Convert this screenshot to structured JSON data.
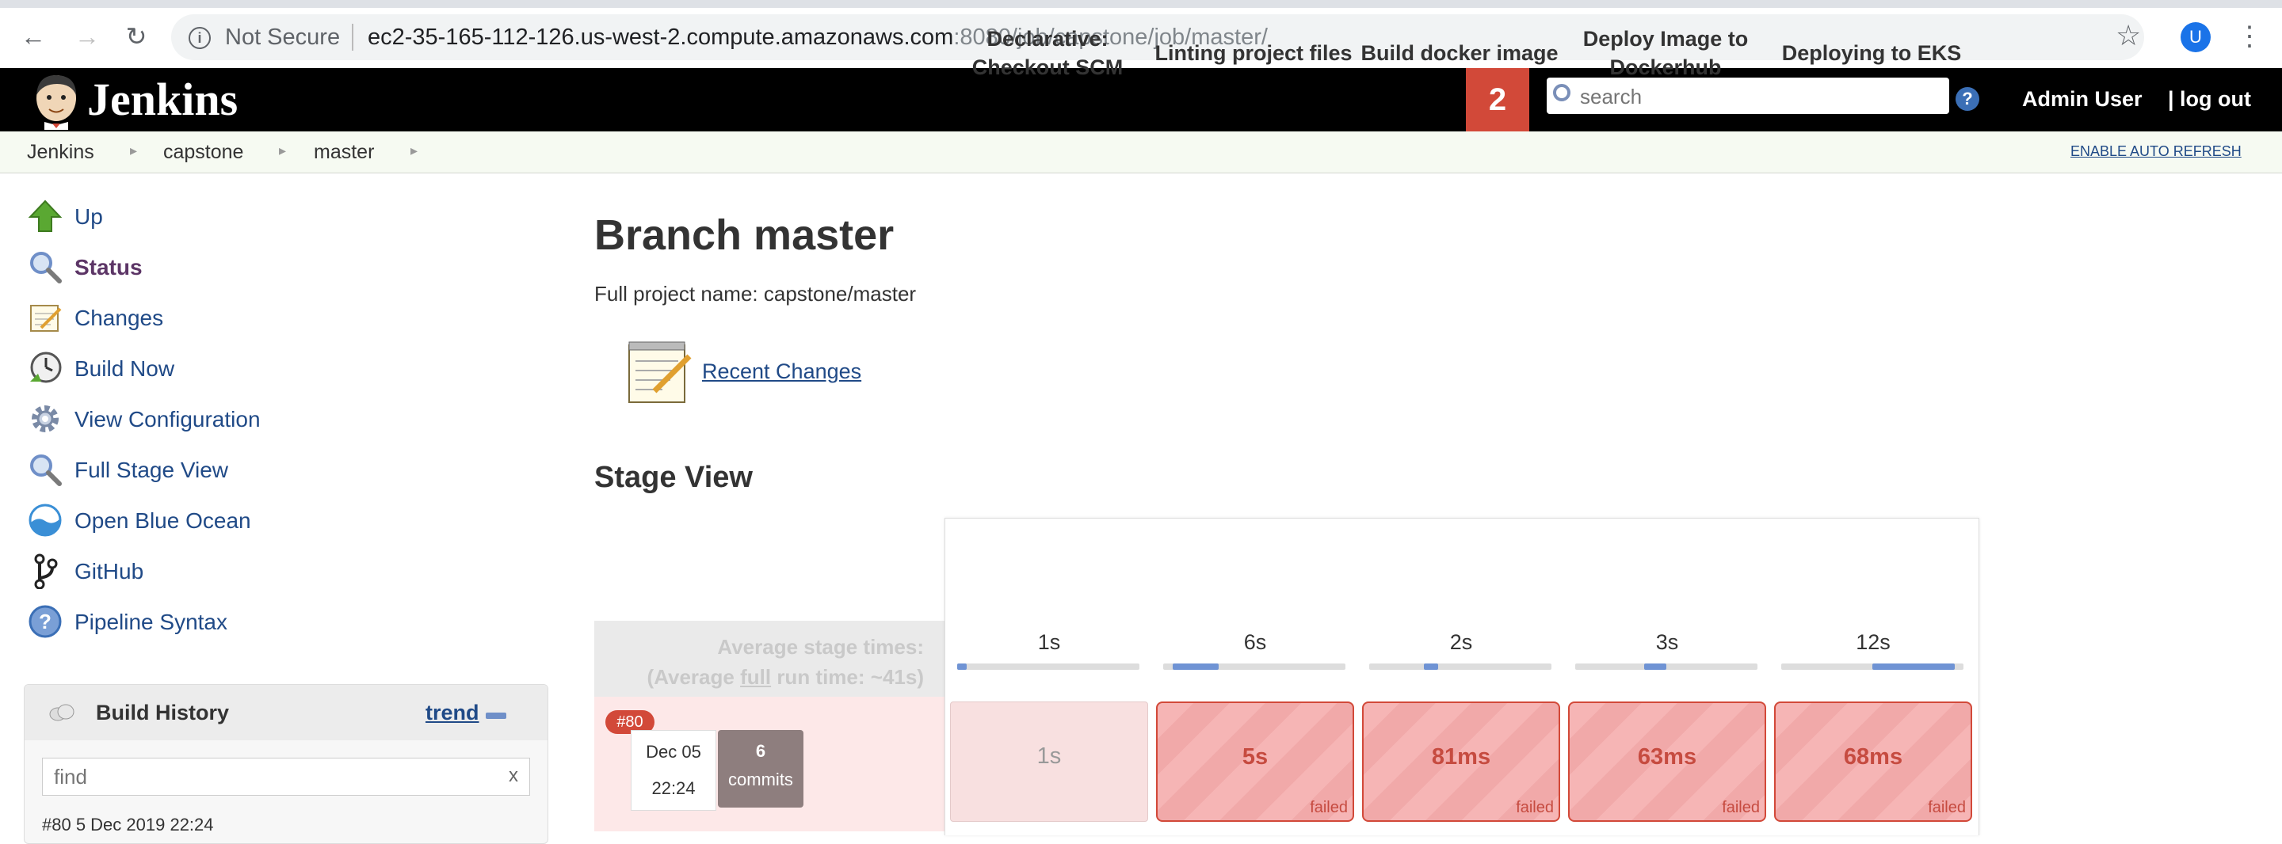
{
  "browser": {
    "security_label": "Not Secure",
    "url_host": "ec2-35-165-112-126.us-west-2.compute.amazonaws.com",
    "url_path": ":8080/job/capstone/job/master/",
    "profile_initial": "U"
  },
  "header": {
    "app_name": "Jenkins",
    "notification_count": "2",
    "search_placeholder": "search",
    "user": "Admin User",
    "logout": "| log out"
  },
  "breadcrumb": {
    "items": [
      "Jenkins",
      "capstone",
      "master"
    ],
    "auto_refresh": "ENABLE AUTO REFRESH"
  },
  "sidebar": {
    "tasks": [
      {
        "label": "Up",
        "icon": "up-arrow-icon"
      },
      {
        "label": "Status",
        "icon": "magnifier-icon"
      },
      {
        "label": "Changes",
        "icon": "notepad-icon"
      },
      {
        "label": "Build Now",
        "icon": "clock-icon"
      },
      {
        "label": "View Configuration",
        "icon": "gear-icon"
      },
      {
        "label": "Full Stage View",
        "icon": "magnifier-icon"
      },
      {
        "label": "Open Blue Ocean",
        "icon": "blue-ocean-icon"
      },
      {
        "label": "GitHub",
        "icon": "git-branch-icon"
      },
      {
        "label": "Pipeline Syntax",
        "icon": "help-icon"
      }
    ],
    "build_history": {
      "title": "Build History",
      "trend": "trend",
      "find_placeholder": "find",
      "clear": "x",
      "first_row": "#80         5 Dec 2019 22:24"
    }
  },
  "main": {
    "title": "Branch master",
    "full_project_name": "Full project name: capstone/master",
    "recent_changes": "Recent Changes",
    "stage_view_title": "Stage View"
  },
  "stage_view": {
    "avg_label_1": "Average stage times:",
    "avg_label_2_prefix": "(Average ",
    "avg_label_2_full": "full",
    "avg_label_2_suffix": " run time: ~41s)",
    "stages": [
      {
        "name": "Declarative: Checkout SCM",
        "avg": "1s",
        "avg_fraction": 0.05
      },
      {
        "name": "Linting project files",
        "avg": "6s",
        "avg_fraction": 0.25
      },
      {
        "name": "Build docker image",
        "avg": "2s",
        "avg_fraction": 0.08
      },
      {
        "name": "Deploy Image to Dockerhub",
        "avg": "3s",
        "avg_fraction": 0.12
      },
      {
        "name": "Deploying to EKS",
        "avg": "12s",
        "avg_fraction": 0.45
      }
    ],
    "run": {
      "number": "#80",
      "date": "Dec 05",
      "time": "22:24",
      "commits_count": "6",
      "commits_label": "commits",
      "cells": [
        {
          "time": "1s",
          "status": ""
        },
        {
          "time": "5s",
          "status": "failed"
        },
        {
          "time": "81ms",
          "status": "failed"
        },
        {
          "time": "63ms",
          "status": "failed"
        },
        {
          "time": "68ms",
          "status": "failed"
        }
      ]
    }
  }
}
